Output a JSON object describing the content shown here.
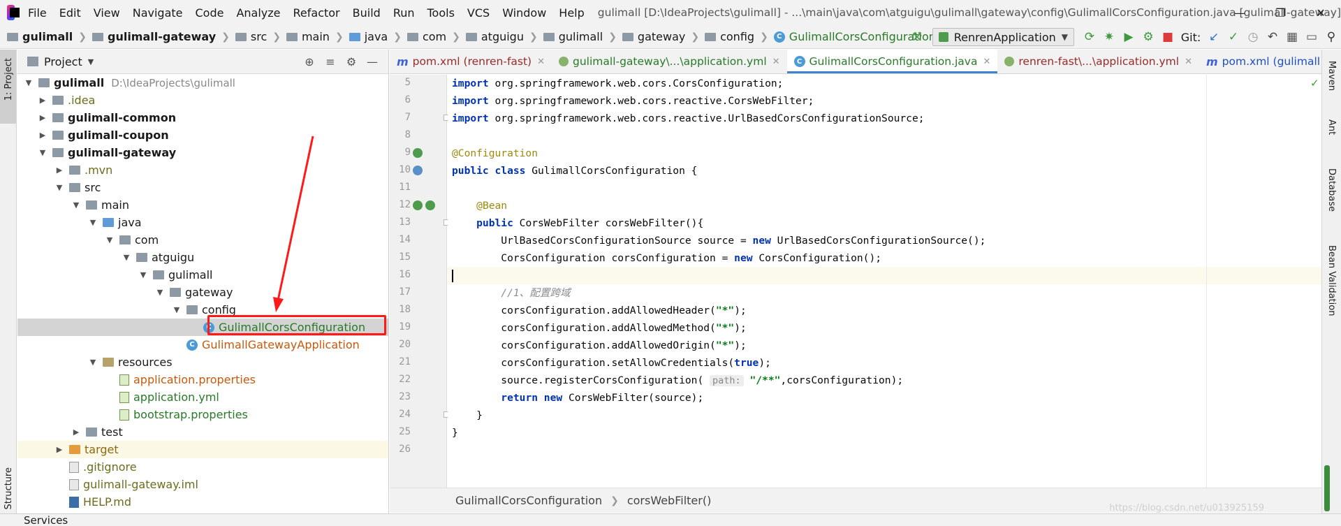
{
  "menu": [
    "File",
    "Edit",
    "View",
    "Navigate",
    "Code",
    "Analyze",
    "Refactor",
    "Build",
    "Run",
    "Tools",
    "VCS",
    "Window",
    "Help"
  ],
  "window_title": "gulimall [D:\\IdeaProjects\\gulimall] - ...\\main\\java\\com\\atguigu\\gulimall\\gateway\\config\\GulimallCorsConfiguration.java [gulimall-gateway]",
  "nav_breadcrumb": [
    "gulimall",
    "gulimall-gateway",
    "src",
    "main",
    "java",
    "com",
    "atguigu",
    "gulimall",
    "gateway",
    "config",
    "GulimallCorsConfiguration"
  ],
  "toolbar": {
    "run_config": "RenrenApplication",
    "git_label": "Git:"
  },
  "left_strip": {
    "project_tab": "1: Project",
    "structure_tab": "Z: Structure"
  },
  "right_strip": [
    "Maven",
    "Ant",
    "Database",
    "Bean Validation"
  ],
  "project_panel": {
    "title": "Project",
    "tree": [
      {
        "label": "gulimall",
        "path": "D:\\IdeaProjects\\gulimall"
      },
      {
        "label": ".idea"
      },
      {
        "label": "gulimall-common"
      },
      {
        "label": "gulimall-coupon"
      },
      {
        "label": "gulimall-gateway"
      },
      {
        "label": ".mvn"
      },
      {
        "label": "src"
      },
      {
        "label": "main"
      },
      {
        "label": "java"
      },
      {
        "label": "com"
      },
      {
        "label": "atguigu"
      },
      {
        "label": "gulimall"
      },
      {
        "label": "gateway"
      },
      {
        "label": "config"
      },
      {
        "label": "GulimallCorsConfiguration"
      },
      {
        "label": "GulimallGatewayApplication"
      },
      {
        "label": "resources"
      },
      {
        "label": "application.properties"
      },
      {
        "label": "application.yml"
      },
      {
        "label": "bootstrap.properties"
      },
      {
        "label": "test"
      },
      {
        "label": "target"
      },
      {
        "label": ".gitignore"
      },
      {
        "label": "gulimall-gateway.iml"
      },
      {
        "label": "HELP.md"
      }
    ]
  },
  "tabs": [
    {
      "label": "pom.xml (renren-fast)"
    },
    {
      "label": "gulimall-gateway\\...\\application.yml"
    },
    {
      "label": "GulimallCorsConfiguration.java"
    },
    {
      "label": "renren-fast\\...\\application.yml"
    },
    {
      "label": "pom.xml (gulimall"
    }
  ],
  "code": {
    "line_numbers": [
      "5",
      "6",
      "7",
      "8",
      "9",
      "10",
      "11",
      "12",
      "13",
      "14",
      "15",
      "16",
      "17",
      "18",
      "19",
      "20",
      "21",
      "22",
      "23",
      "24",
      "25",
      "26"
    ],
    "l5_kw": "import",
    "l5_rest": " org.springframework.web.cors.CorsConfiguration;",
    "l6_kw": "import",
    "l6_rest": " org.springframework.web.cors.reactive.CorsWebFilter;",
    "l7_kw": "import",
    "l7_rest": " org.springframework.web.cors.reactive.UrlBasedCorsConfigurationSource;",
    "l9_ann": "@Configuration",
    "l10_kw": "public class",
    "l10_rest": " GulimallCorsConfiguration {",
    "l12_ann": "@Bean",
    "l13_kw": "public",
    "l13_rest": " CorsWebFilter corsWebFilter(){",
    "l14_a": "UrlBasedCorsConfigurationSource source = ",
    "l14_kw": "new",
    "l14_b": " UrlBasedCorsConfigurationSource();",
    "l15_a": "CorsConfiguration corsConfiguration = ",
    "l15_kw": "new",
    "l15_b": " CorsConfiguration();",
    "l17_cmt": "//1、配置跨域",
    "l18_a": "corsConfiguration.addAllowedHeader(",
    "l18_str": "\"*\"",
    "l18_b": ");",
    "l19_a": "corsConfiguration.addAllowedMethod(",
    "l19_str": "\"*\"",
    "l19_b": ");",
    "l20_a": "corsConfiguration.addAllowedOrigin(",
    "l20_str": "\"*\"",
    "l20_b": ");",
    "l21_a": "corsConfiguration.setAllowCredentials(",
    "l21_kw": "true",
    "l21_b": ");",
    "l22_a": "source.registerCorsConfiguration(",
    "l22_hint": "path:",
    "l22_str": "\"/**\"",
    "l22_b": ",corsConfiguration);",
    "l23_kw": "return new",
    "l23_rest": " CorsWebFilter(source);",
    "l24": "}",
    "l25": "}"
  },
  "editor_breadcrumb": [
    "GulimallCorsConfiguration",
    "corsWebFilter()"
  ],
  "status": {
    "services": "Services",
    "watermark": "https://blog.csdn.net/u013925159"
  }
}
